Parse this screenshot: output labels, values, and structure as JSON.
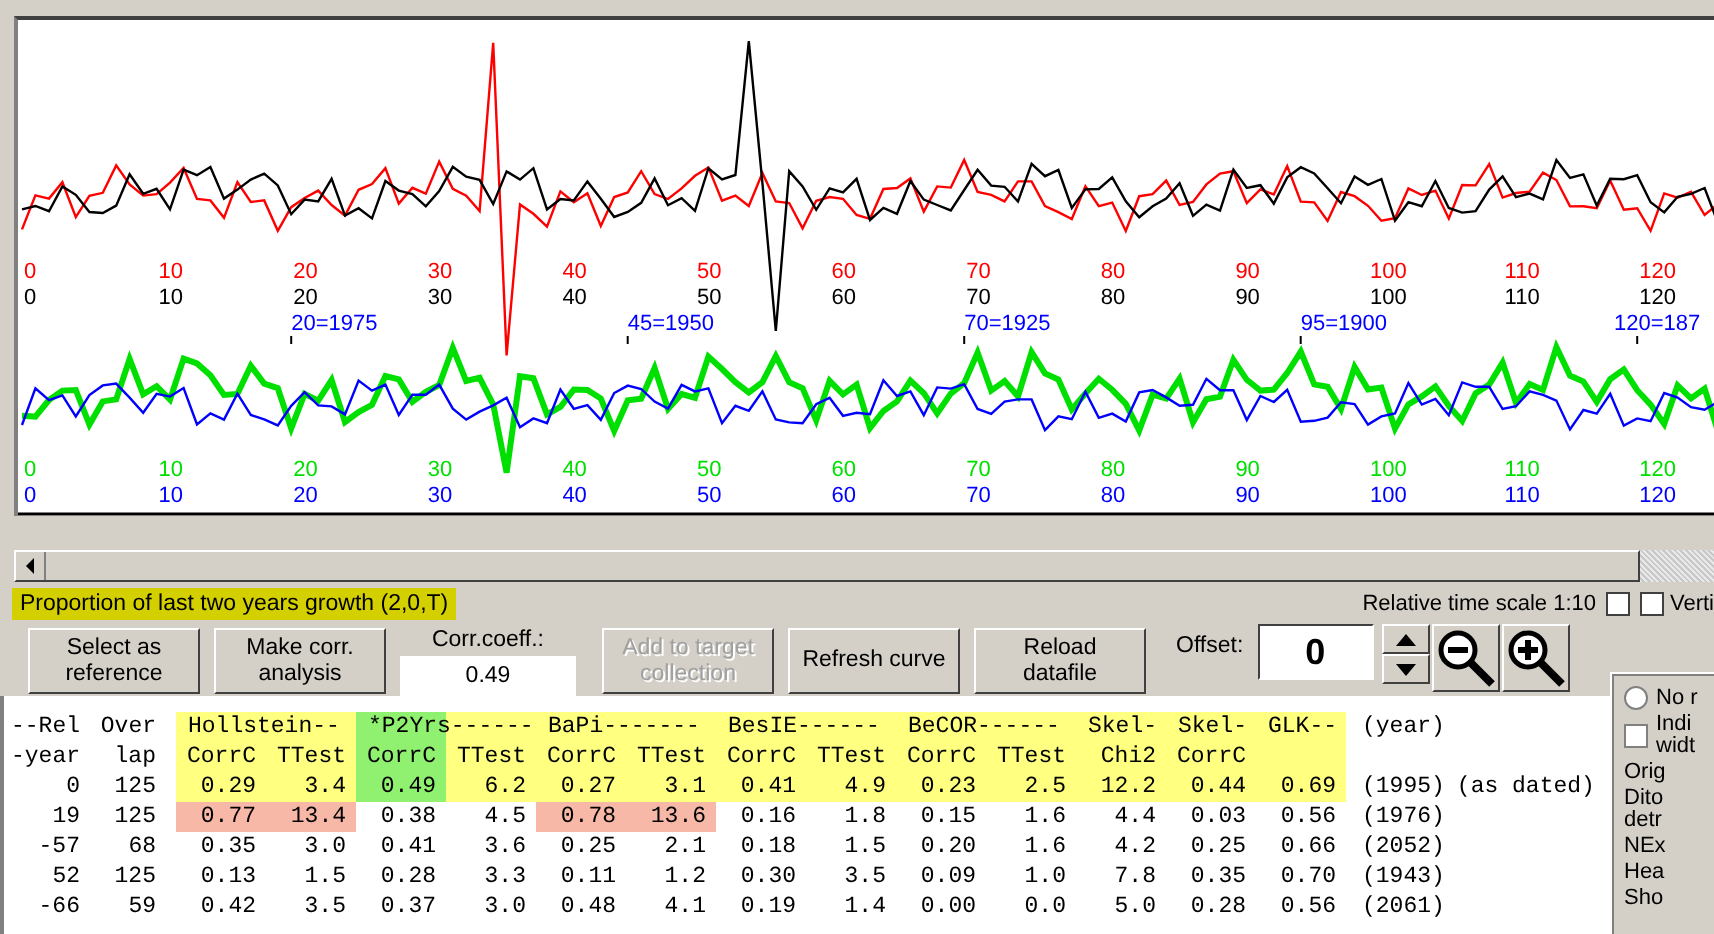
{
  "plot": {
    "series": [
      {
        "color": "#ff0000",
        "labels": [
          "0",
          "10",
          "20",
          "30",
          "40",
          "50",
          "60",
          "70",
          "80",
          "90",
          "100",
          "110",
          "120"
        ]
      },
      {
        "color": "#000000",
        "labels": [
          "0",
          "10",
          "20",
          "30",
          "40",
          "50",
          "60",
          "70",
          "80",
          "90",
          "100",
          "110",
          "120"
        ]
      },
      {
        "color": "#00e000",
        "labels": [
          "0",
          "10",
          "20",
          "30",
          "40",
          "50",
          "60",
          "70",
          "80",
          "90",
          "100",
          "110",
          "120"
        ]
      },
      {
        "color": "#0000ff",
        "labels": [
          "0",
          "10",
          "20",
          "30",
          "40",
          "50",
          "60",
          "70",
          "80",
          "90",
          "100",
          "110",
          "120"
        ]
      }
    ],
    "year_marks": [
      "20=1975",
      "45=1950",
      "70=1925",
      "95=1900",
      "120=187"
    ]
  },
  "method_label": "Proportion of last two years growth (2,0,T)",
  "time_scale": {
    "label": "Relative time scale 1:10",
    "checked": false
  },
  "vertical_option": {
    "label": "Verti",
    "checked": false
  },
  "buttons": [
    {
      "label": "Select as reference",
      "disabled": false
    },
    {
      "label": "Make corr. analysis",
      "disabled": false
    },
    {
      "label": "Add to target collection",
      "disabled": true
    },
    {
      "label": "Refresh curve",
      "disabled": false
    },
    {
      "label": "Reload datafile",
      "disabled": false
    }
  ],
  "corr_coeff": {
    "label": "Corr.coeff.:",
    "value": "0.49"
  },
  "offset": {
    "label": "Offset:",
    "value": "0"
  },
  "options": [
    {
      "kind": "radio",
      "lines": [
        "No r"
      ],
      "selected": false
    },
    {
      "kind": "check",
      "lines": [
        "Indi",
        "widt"
      ],
      "checked": false
    },
    {
      "kind": "text",
      "lines": [
        "Orig"
      ]
    },
    {
      "kind": "text",
      "lines": [
        "Dito",
        "detr"
      ]
    },
    {
      "kind": "text",
      "lines": [
        "NEx"
      ]
    },
    {
      "kind": "text",
      "lines": [
        "Hea"
      ]
    },
    {
      "kind": "text",
      "lines": [
        "Sho"
      ]
    }
  ],
  "table": {
    "left_headings": [
      [
        "--Rel",
        "Over"
      ],
      [
        "-year",
        "lap"
      ]
    ],
    "groups": [
      {
        "name": "Hollstein--",
        "columns": [
          {
            "label": "CorrC",
            "selected": false
          },
          {
            "label": "TTest",
            "selected": false
          }
        ]
      },
      {
        "name": "*P2Yrs------",
        "columns": [
          {
            "label": "CorrC",
            "selected": true
          },
          {
            "label": "TTest",
            "selected": false
          }
        ]
      },
      {
        "name": "BaPi-------",
        "columns": [
          {
            "label": "CorrC",
            "selected": false
          },
          {
            "label": "TTest",
            "selected": false
          }
        ]
      },
      {
        "name": "BesIE------",
        "columns": [
          {
            "label": "CorrC",
            "selected": false
          },
          {
            "label": "TTest",
            "selected": false
          }
        ]
      },
      {
        "name": "BeCOR------",
        "columns": [
          {
            "label": "CorrC",
            "selected": false
          },
          {
            "label": "TTest",
            "selected": false
          }
        ]
      },
      {
        "name": "Skel-",
        "columns": [
          {
            "label": "Chi2",
            "selected": false
          }
        ]
      },
      {
        "name": "Skel-",
        "columns": [
          {
            "label": "CorrC",
            "selected": false
          }
        ]
      },
      {
        "name": "GLK--",
        "columns": [
          {
            "selected": false
          }
        ]
      }
    ],
    "year_heading": "(year)",
    "rows": [
      {
        "rel": "0",
        "overlap": "125",
        "reference": true,
        "year": "(1995)",
        "note": "(as dated)",
        "values": [
          {
            "text": "0.29",
            "flagged": false
          },
          {
            "text": "3.4",
            "flagged": false
          },
          {
            "text": "0.49",
            "flagged": false
          },
          {
            "text": "6.2",
            "flagged": false
          },
          {
            "text": "0.27",
            "flagged": false
          },
          {
            "text": "3.1",
            "flagged": false
          },
          {
            "text": "0.41",
            "flagged": false
          },
          {
            "text": "4.9",
            "flagged": false
          },
          {
            "text": "0.23",
            "flagged": false
          },
          {
            "text": "2.5",
            "flagged": false
          },
          {
            "text": "12.2",
            "flagged": false
          },
          {
            "text": "0.44",
            "flagged": false
          },
          {
            "text": "0.69",
            "flagged": false
          }
        ]
      },
      {
        "rel": "19",
        "overlap": "125",
        "reference": false,
        "year": "(1976)",
        "values": [
          {
            "text": "0.77",
            "flagged": true
          },
          {
            "text": "13.4",
            "flagged": true
          },
          {
            "text": "0.38",
            "flagged": false
          },
          {
            "text": "4.5",
            "flagged": false
          },
          {
            "text": "0.78",
            "flagged": true
          },
          {
            "text": "13.6",
            "flagged": true
          },
          {
            "text": "0.16",
            "flagged": false
          },
          {
            "text": "1.8",
            "flagged": false
          },
          {
            "text": "0.15",
            "flagged": false
          },
          {
            "text": "1.6",
            "flagged": false
          },
          {
            "text": "4.4",
            "flagged": false
          },
          {
            "text": "0.03",
            "flagged": false
          },
          {
            "text": "0.56",
            "flagged": false
          }
        ]
      },
      {
        "rel": "-57",
        "overlap": "68",
        "reference": false,
        "year": "(2052)",
        "values": [
          {
            "text": "0.35",
            "flagged": false
          },
          {
            "text": "3.0",
            "flagged": false
          },
          {
            "text": "0.41",
            "flagged": false
          },
          {
            "text": "3.6",
            "flagged": false
          },
          {
            "text": "0.25",
            "flagged": false
          },
          {
            "text": "2.1",
            "flagged": false
          },
          {
            "text": "0.18",
            "flagged": false
          },
          {
            "text": "1.5",
            "flagged": false
          },
          {
            "text": "0.20",
            "flagged": false
          },
          {
            "text": "1.6",
            "flagged": false
          },
          {
            "text": "4.2",
            "flagged": false
          },
          {
            "text": "0.25",
            "flagged": false
          },
          {
            "text": "0.66",
            "flagged": false
          }
        ]
      },
      {
        "rel": "52",
        "overlap": "125",
        "reference": false,
        "year": "(1943)",
        "values": [
          {
            "text": "0.13",
            "flagged": false
          },
          {
            "text": "1.5",
            "flagged": false
          },
          {
            "text": "0.28",
            "flagged": false
          },
          {
            "text": "3.3",
            "flagged": false
          },
          {
            "text": "0.11",
            "flagged": false
          },
          {
            "text": "1.2",
            "flagged": false
          },
          {
            "text": "0.30",
            "flagged": false
          },
          {
            "text": "3.5",
            "flagged": false
          },
          {
            "text": "0.09",
            "flagged": false
          },
          {
            "text": "1.0",
            "flagged": false
          },
          {
            "text": "7.8",
            "flagged": false
          },
          {
            "text": "0.35",
            "flagged": false
          },
          {
            "text": "0.70",
            "flagged": false
          }
        ]
      },
      {
        "rel": "-66",
        "overlap": "59",
        "reference": false,
        "year": "(2061)",
        "values": [
          {
            "text": "0.42",
            "flagged": false
          },
          {
            "text": "3.5",
            "flagged": false
          },
          {
            "text": "0.37",
            "flagged": false
          },
          {
            "text": "3.0",
            "flagged": false
          },
          {
            "text": "0.48",
            "flagged": false
          },
          {
            "text": "4.1",
            "flagged": false
          },
          {
            "text": "0.19",
            "flagged": false
          },
          {
            "text": "1.4",
            "flagged": false
          },
          {
            "text": "0.00",
            "flagged": false
          },
          {
            "text": "0.0",
            "flagged": false
          },
          {
            "text": "5.0",
            "flagged": false
          },
          {
            "text": "0.28",
            "flagged": false
          },
          {
            "text": "0.56",
            "flagged": false
          }
        ]
      }
    ]
  }
}
